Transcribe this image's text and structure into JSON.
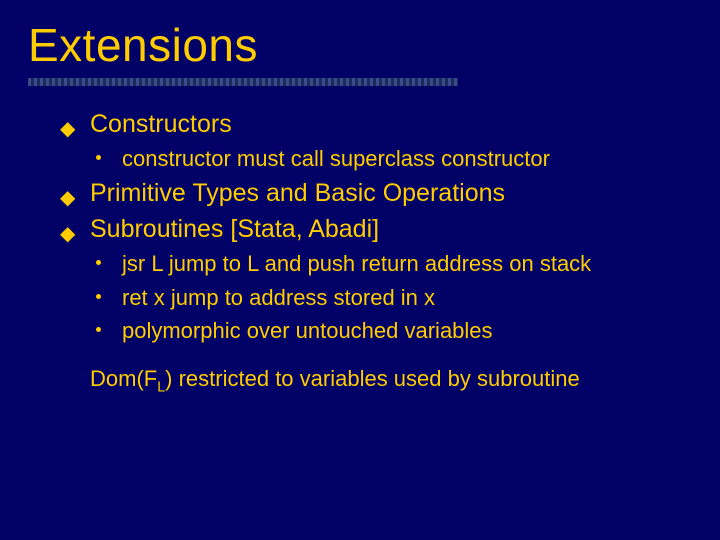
{
  "slide": {
    "title": "Extensions",
    "items": [
      {
        "level": 1,
        "text": "Constructors"
      },
      {
        "level": 2,
        "text": "constructor must call superclass constructor"
      },
      {
        "level": 1,
        "text": "Primitive Types and Basic Operations"
      },
      {
        "level": 1,
        "text": "Subroutines [Stata, Abadi]"
      },
      {
        "level": 2,
        "text": "jsr L   jump to L and push return address on stack"
      },
      {
        "level": 2,
        "text": "ret x   jump to address stored in x"
      },
      {
        "level": 2,
        "text": "polymorphic over untouched variables"
      }
    ],
    "footnote_prefix": "Dom(F",
    "footnote_sub": "L",
    "footnote_suffix": ") restricted to variables used by subroutine"
  }
}
